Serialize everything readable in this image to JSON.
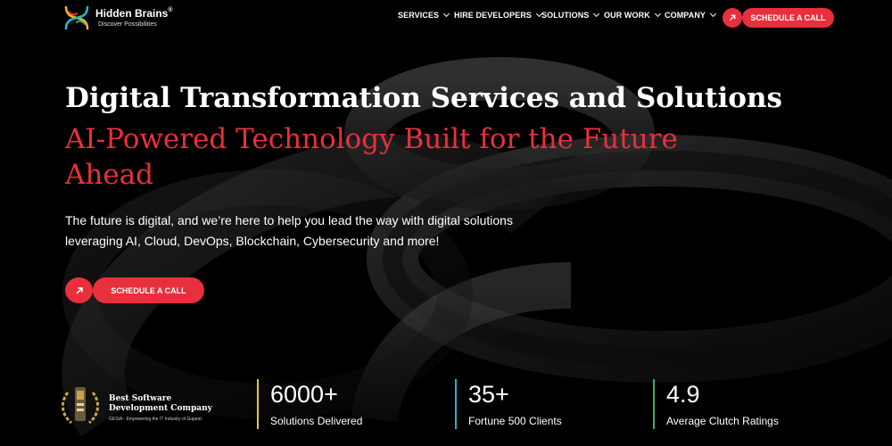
{
  "colors": {
    "accent": "#e8303c",
    "background": "#000000",
    "text": "#ffffff",
    "gold": "#f0c040",
    "cyan": "#2db3c7",
    "green": "#3fae6a"
  },
  "header": {
    "logo": {
      "name": "Hidden Brains",
      "reg": "®",
      "tagline": "Discover Possibilities",
      "icon": "hidden-brains-logo"
    },
    "nav": [
      {
        "label": "SERVICES",
        "has_dropdown": true
      },
      {
        "label": "HIRE DEVELOPERS",
        "has_dropdown": true
      },
      {
        "label": "SOLUTIONS",
        "has_dropdown": true
      },
      {
        "label": "OUR WORK",
        "has_dropdown": true
      },
      {
        "label": "COMPANY",
        "has_dropdown": true
      }
    ],
    "cta": {
      "label": "SCHEDULE A CALL",
      "icon": "arrow-up-right-icon"
    }
  },
  "hero": {
    "title": "Digital Transformation Services and Solutions",
    "subtitle": "AI-Powered Technology Built for the Future Ahead",
    "description": "The future is digital, and we’re here to help you lead the way with digital solutions leveraging AI, Cloud, DevOps, Blockchain, Cybersecurity and more!",
    "cta": {
      "label": "SCHEDULE A CALL",
      "icon": "arrow-up-right-icon"
    }
  },
  "badge": {
    "title": "Best Software Development Company",
    "caption": "GESIA - Empowering the IT Industry of Gujarat",
    "icon": "award-laurel-icon"
  },
  "stats": [
    {
      "value": "6000+",
      "label": "Solutions Delivered",
      "color": "#f0c040"
    },
    {
      "value": "35+",
      "label": "Fortune 500 Clients",
      "color": "#2db3c7"
    },
    {
      "value": "4.9",
      "label": "Average Clutch Ratings",
      "color": "#3fae6a"
    }
  ]
}
